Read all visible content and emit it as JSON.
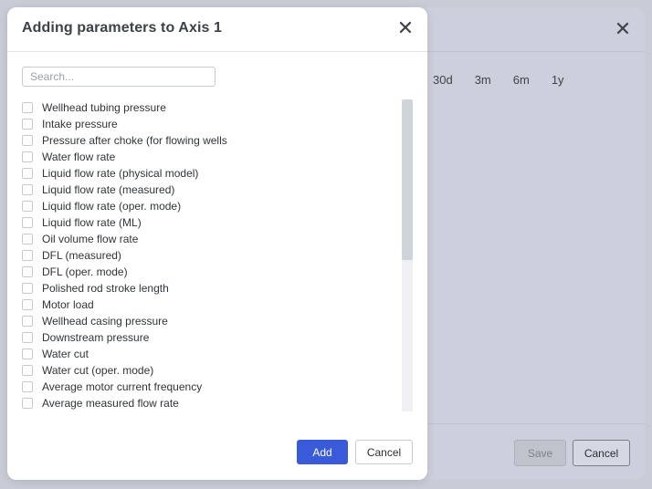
{
  "background_dialog": {
    "time_ranges": [
      "30d",
      "3m",
      "6m",
      "1y"
    ],
    "save_label": "Save",
    "cancel_label": "Cancel"
  },
  "modal": {
    "title": "Adding parameters to Axis 1",
    "search_placeholder": "Search...",
    "search_value": "",
    "items": [
      {
        "label": "Wellhead tubing pressure",
        "checked": false
      },
      {
        "label": "Intake pressure",
        "checked": false
      },
      {
        "label": "Pressure after choke (for flowing wells",
        "checked": false
      },
      {
        "label": "Water flow rate",
        "checked": false
      },
      {
        "label": "Liquid flow rate (physical model)",
        "checked": false
      },
      {
        "label": "Liquid flow rate (measured)",
        "checked": false
      },
      {
        "label": "Liquid flow rate (oper. mode)",
        "checked": false
      },
      {
        "label": "Liquid flow rate (ML)",
        "checked": false
      },
      {
        "label": "Oil volume flow rate",
        "checked": false
      },
      {
        "label": "DFL (measured)",
        "checked": false
      },
      {
        "label": "DFL (oper. mode)",
        "checked": false
      },
      {
        "label": "Polished rod stroke length",
        "checked": false
      },
      {
        "label": "Motor load",
        "checked": false
      },
      {
        "label": "Wellhead casing pressure",
        "checked": false
      },
      {
        "label": "Downstream pressure",
        "checked": false
      },
      {
        "label": "Water cut",
        "checked": false
      },
      {
        "label": "Water cut (oper. mode)",
        "checked": false
      },
      {
        "label": "Average motor current frequency",
        "checked": false
      },
      {
        "label": "Average measured flow rate",
        "checked": false
      }
    ],
    "add_label": "Add",
    "cancel_label": "Cancel"
  },
  "colors": {
    "accent": "#3a5bd9",
    "overlay": "#c9ccd6"
  }
}
